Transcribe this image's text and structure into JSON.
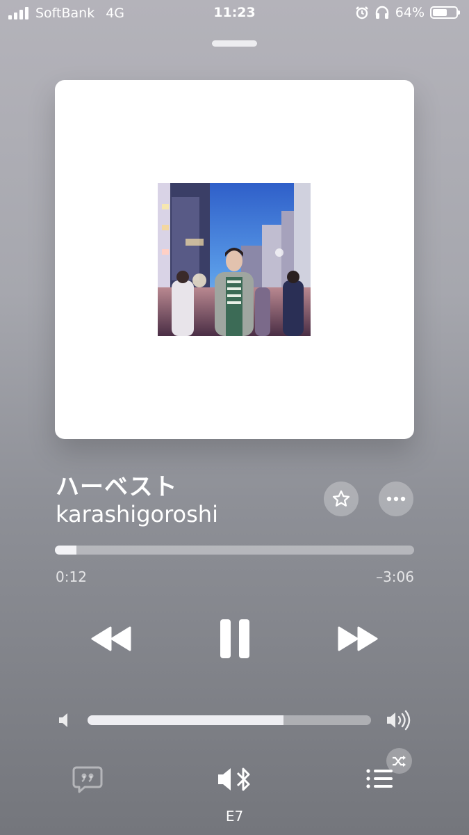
{
  "status_bar": {
    "carrier": "SoftBank",
    "network": "4G",
    "time": "11:23",
    "battery_percent_label": "64%",
    "battery_level": 0.64
  },
  "now_playing": {
    "title": "ハーベスト",
    "artist": "karashigoroshi",
    "elapsed": "0:12",
    "remaining": "–3:06",
    "progress": 0.06,
    "volume": 0.69,
    "output_device": "E7"
  },
  "icons": {
    "star": "star-icon",
    "more": "ellipsis-icon",
    "rewind": "rewind-icon",
    "pause": "pause-icon",
    "forward": "fast-forward-icon",
    "volume_low": "speaker-low-icon",
    "volume_high": "speaker-high-icon",
    "lyrics": "lyrics-quote-icon",
    "airplay": "speaker-bluetooth-icon",
    "queue": "list-icon",
    "shuffle": "shuffle-icon"
  },
  "colors": {
    "background_top": "#b4b3ba",
    "background_bottom": "#74767c",
    "artwork_bg": "#ffffff"
  }
}
